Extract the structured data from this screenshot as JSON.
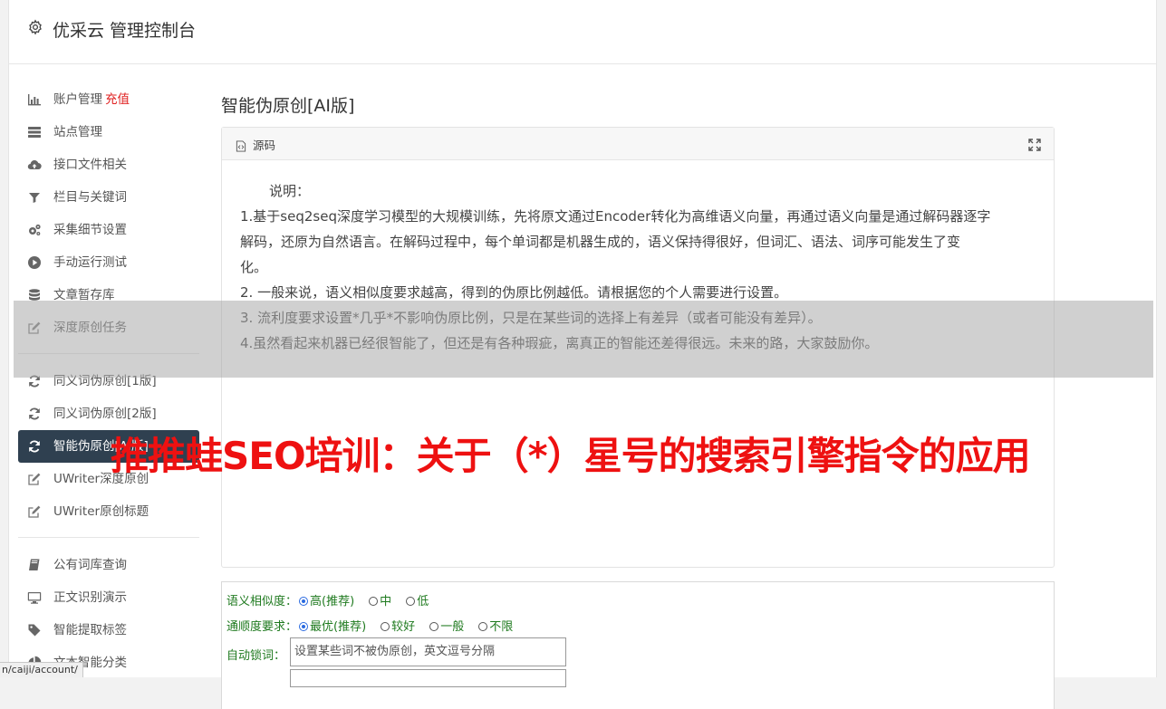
{
  "app": {
    "title": "优采云 管理控制台",
    "icon": "gear-icon"
  },
  "sidebar": {
    "groups": [
      [
        {
          "label": "账户管理",
          "badge": "充值",
          "icon": "bar-chart-icon"
        },
        {
          "label": "站点管理",
          "icon": "server-icon"
        },
        {
          "label": "接口文件相关",
          "icon": "cloud-upload-icon"
        },
        {
          "label": "栏目与关键词",
          "icon": "filter-icon"
        },
        {
          "label": "采集细节设置",
          "icon": "cogs-icon"
        },
        {
          "label": "手动运行测试",
          "icon": "play-circle-icon"
        },
        {
          "label": "文章暂存库",
          "icon": "database-icon"
        },
        {
          "label": "深度原创任务",
          "icon": "edit-icon"
        }
      ],
      [
        {
          "label": "同义词伪原创[1版]",
          "icon": "refresh-icon"
        },
        {
          "label": "同义词伪原创[2版]",
          "icon": "refresh-icon"
        },
        {
          "label": "智能伪原创[AI版]",
          "icon": "refresh-icon",
          "active": true
        },
        {
          "label": "UWriter深度原创",
          "icon": "edit-icon"
        },
        {
          "label": "UWriter原创标题",
          "icon": "edit-icon"
        }
      ],
      [
        {
          "label": "公有词库查询",
          "icon": "book-icon"
        },
        {
          "label": "正文识别演示",
          "icon": "monitor-icon"
        },
        {
          "label": "智能提取标签",
          "icon": "tag-icon"
        },
        {
          "label": "文本智能分类",
          "icon": "pie-chart-icon"
        }
      ]
    ]
  },
  "main": {
    "title": "智能伪原创[AI版]",
    "panel": {
      "header": "源码",
      "intro": "说明：",
      "lines": [
        "1.基于seq2seq深度学习模型的大规模训练，先将原文通过Encoder转化为高维语义向量，再通过语义向量是通过解码器逐字",
        "解码，还原为自然语言。在解码过程中，每个单词都是机器生成的，语义保持得很好，但词汇、语法、词序可能发生了变",
        "化。",
        "2. 一般来说，语义相似度要求越高，得到的伪原比例越低。请根据您的个人需要进行设置。",
        "3. 流利度要求设置*几乎*不影响伪原比例，只是在某些词的选择上有差异（或者可能没有差异）。",
        "4.虽然看起来机器已经很智能了，但还是有各种瑕疵，离真正的智能还差得很远。未来的路，大家鼓励你。"
      ]
    },
    "options": {
      "similarity": {
        "label": "语义相似度：",
        "choices": [
          "高(推荐)",
          "中",
          "低"
        ],
        "selected": 0
      },
      "fluency": {
        "label": "通顺度要求：",
        "choices": [
          "最优(推荐)",
          "较好",
          "一般",
          "不限"
        ],
        "selected": 0
      },
      "lock": {
        "label": "自动锁词：",
        "placeholder": "设置某些词不被伪原创，英文逗号分隔"
      }
    }
  },
  "overlay": {
    "headline": "推推蛙SEO培训：关于（*）星号的搜索引擎指令的应用"
  },
  "statusbar": {
    "url": "n/caiji/account/"
  },
  "colors": {
    "active_bg": "#2f4050",
    "badge": "#e02020",
    "headline": "#ee1111",
    "option_text": "#1f7a1f"
  }
}
